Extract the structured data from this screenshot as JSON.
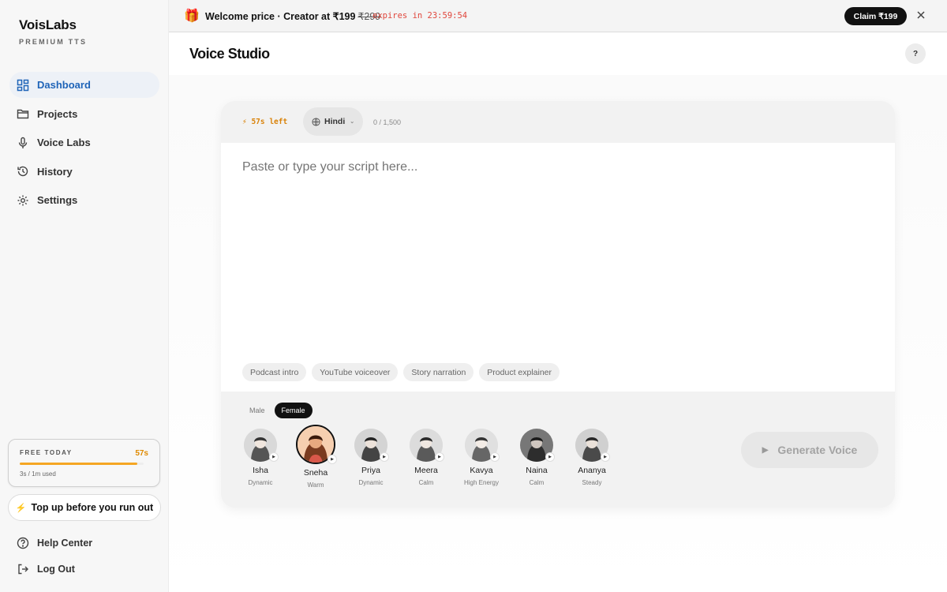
{
  "brand": {
    "name": "VoisLabs",
    "subtitle": "PREMIUM TTS"
  },
  "sidebar": {
    "items": [
      {
        "label": "Dashboard",
        "icon": "grid-icon",
        "active": true
      },
      {
        "label": "Projects",
        "icon": "folder-icon",
        "active": false
      },
      {
        "label": "Voice Labs",
        "icon": "microphone-icon",
        "active": false
      },
      {
        "label": "History",
        "icon": "history-icon",
        "active": false
      },
      {
        "label": "Settings",
        "icon": "gear-icon",
        "active": false
      }
    ],
    "free_card": {
      "label": "FREE TODAY",
      "time": "57s",
      "used": "3s / 1m used",
      "progress": 0.95
    },
    "topup_label": "Top up before you run out",
    "help_label": "Help Center",
    "logout_label": "Log Out"
  },
  "promo": {
    "text": "Welcome price · Creator at ₹199",
    "old_price": "₹299",
    "expires": "expires in 23:59:54",
    "claim_label": "Claim ₹199"
  },
  "header": {
    "title": "Voice Studio",
    "help_label": "?"
  },
  "studio": {
    "time_left": "57s left",
    "language": "Hindi",
    "char_count": "0 / 1,500",
    "script_placeholder": "Paste or type your script here...",
    "chips": [
      "Podcast intro",
      "YouTube voiceover",
      "Story narration",
      "Product explainer"
    ],
    "gender": {
      "male": "Male",
      "female": "Female",
      "selected": "Female"
    },
    "voices": [
      {
        "name": "Isha",
        "tag": "Dynamic"
      },
      {
        "name": "Sneha",
        "tag": "Warm",
        "selected": true
      },
      {
        "name": "Priya",
        "tag": "Dynamic"
      },
      {
        "name": "Meera",
        "tag": "Calm"
      },
      {
        "name": "Kavya",
        "tag": "High Energy"
      },
      {
        "name": "Naina",
        "tag": "Calm"
      },
      {
        "name": "Ananya",
        "tag": "Steady"
      }
    ],
    "generate_label": "Generate Voice"
  },
  "colors": {
    "accent_blue": "#1f64b8",
    "warning_orange": "#e08a00",
    "expiry_red": "#e0463c",
    "dark": "#111111"
  }
}
